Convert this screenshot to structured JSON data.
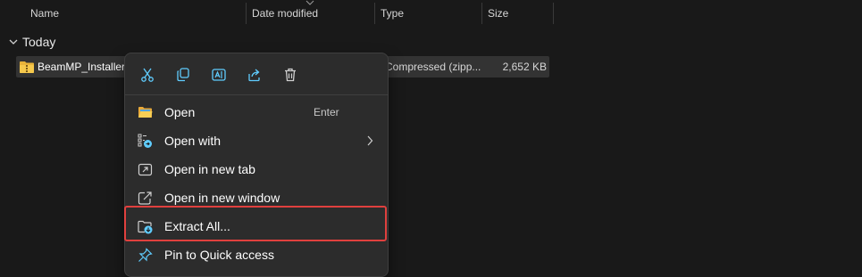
{
  "columns": {
    "name": "Name",
    "date_modified": "Date modified",
    "type": "Type",
    "size": "Size"
  },
  "group": {
    "label": "Today"
  },
  "file": {
    "name": "BeamMP_Installer",
    "type": "Compressed (zipp...",
    "size": "2,652 KB",
    "icon": "zip-folder-icon"
  },
  "context_menu": {
    "quick_actions": [
      "cut",
      "copy",
      "rename",
      "share",
      "delete"
    ],
    "items": [
      {
        "label": "Open",
        "accelerator": "Enter",
        "icon": "folder-open-icon"
      },
      {
        "label": "Open with",
        "icon": "open-with-icon",
        "submenu": true
      },
      {
        "label": "Open in new tab",
        "icon": "new-tab-icon"
      },
      {
        "label": "Open in new window",
        "icon": "new-window-icon"
      },
      {
        "label": "Extract All...",
        "icon": "extract-icon",
        "highlighted": true
      },
      {
        "label": "Pin to Quick access",
        "icon": "pin-icon"
      }
    ]
  },
  "colors": {
    "background": "#191919",
    "menu_background": "#2c2c2c",
    "selected_row": "#333333",
    "highlight_border": "#e0403e",
    "icon_blue": "#60cdff"
  }
}
